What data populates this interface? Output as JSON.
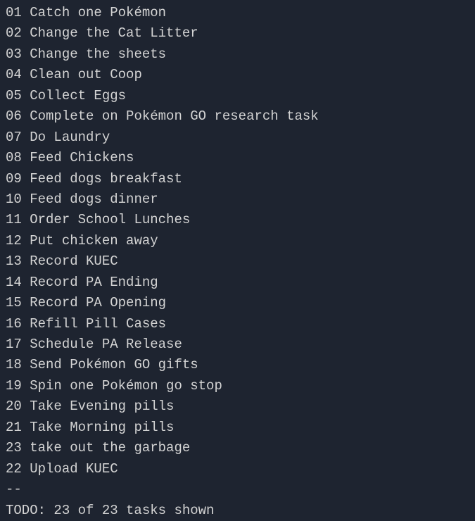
{
  "tasks": [
    {
      "num": "01",
      "text": "Catch one Pokémon"
    },
    {
      "num": "02",
      "text": "Change the Cat Litter"
    },
    {
      "num": "03",
      "text": "Change the sheets"
    },
    {
      "num": "04",
      "text": "Clean out Coop"
    },
    {
      "num": "05",
      "text": "Collect Eggs"
    },
    {
      "num": "06",
      "text": "Complete on Pokémon GO research task"
    },
    {
      "num": "07",
      "text": "Do Laundry"
    },
    {
      "num": "08",
      "text": "Feed Chickens"
    },
    {
      "num": "09",
      "text": "Feed dogs breakfast"
    },
    {
      "num": "10",
      "text": "Feed dogs dinner"
    },
    {
      "num": "11",
      "text": "Order School Lunches"
    },
    {
      "num": "12",
      "text": "Put chicken away"
    },
    {
      "num": "13",
      "text": "Record KUEC"
    },
    {
      "num": "14",
      "text": "Record PA Ending"
    },
    {
      "num": "15",
      "text": "Record PA Opening"
    },
    {
      "num": "16",
      "text": "Refill Pill Cases"
    },
    {
      "num": "17",
      "text": "Schedule PA Release"
    },
    {
      "num": "18",
      "text": "Send Pokémon GO gifts"
    },
    {
      "num": "19",
      "text": "Spin one Pokémon go stop"
    },
    {
      "num": "20",
      "text": "Take Evening pills"
    },
    {
      "num": "21",
      "text": "Take Morning pills"
    },
    {
      "num": "23",
      "text": "take out the garbage"
    },
    {
      "num": "22",
      "text": "Upload KUEC"
    }
  ],
  "separator": "--",
  "status": "TODO: 23 of 23 tasks shown"
}
